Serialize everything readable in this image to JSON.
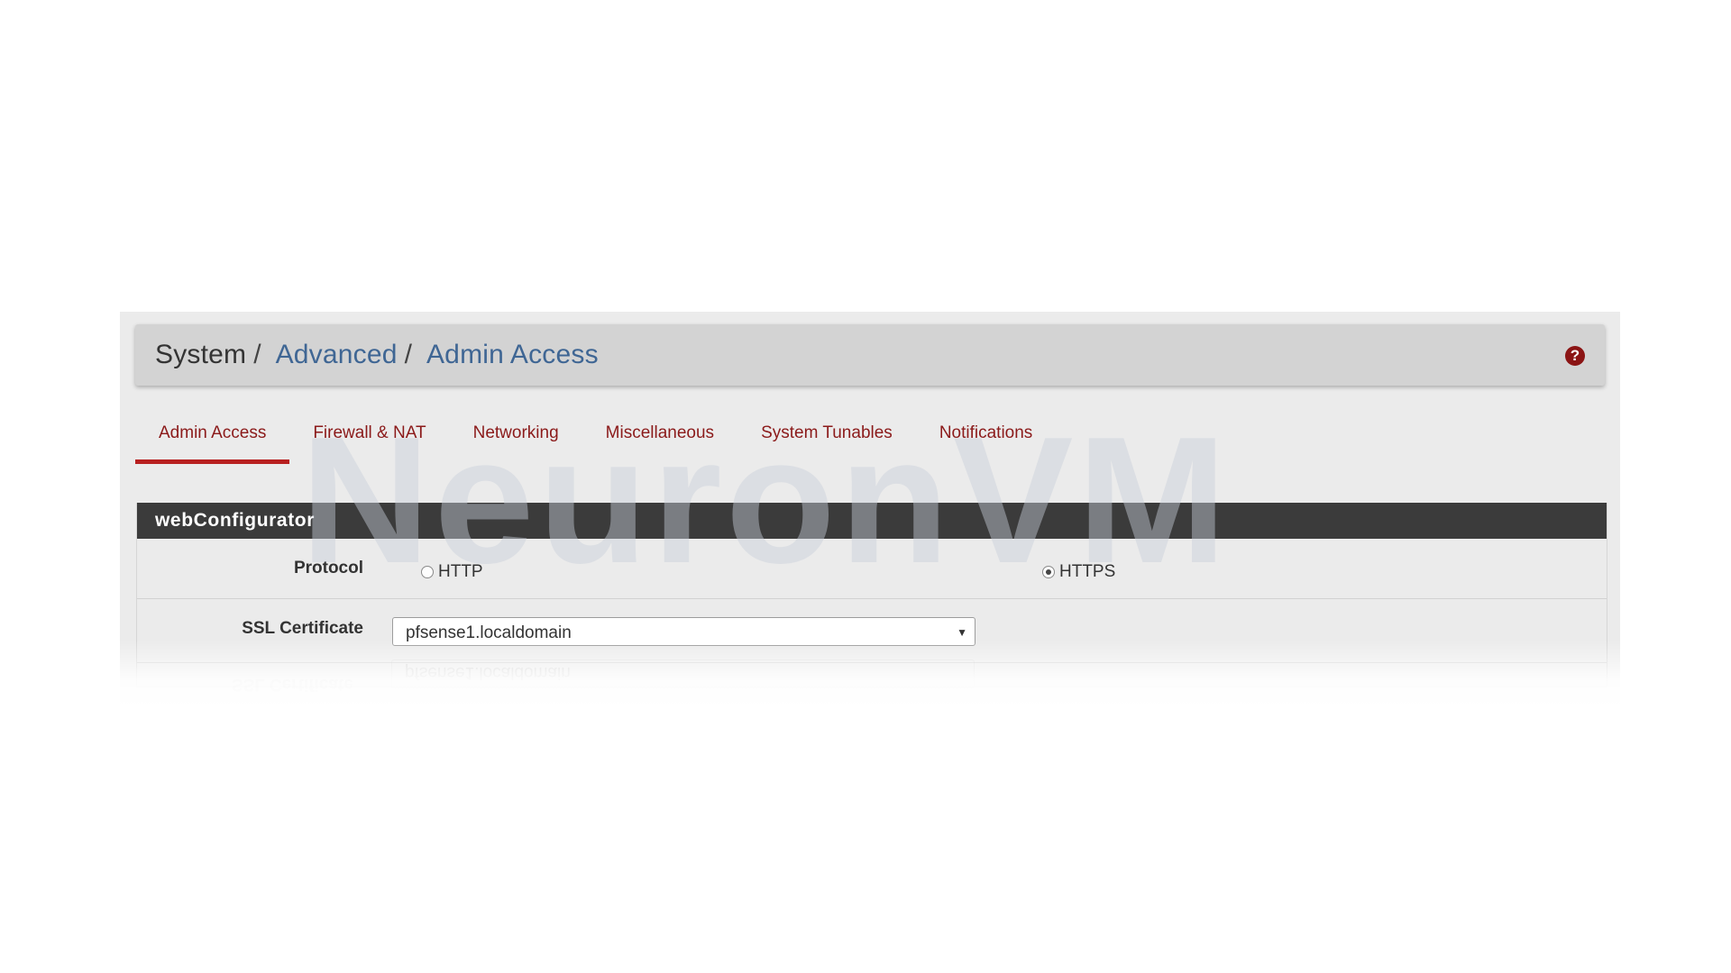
{
  "breadcrumb": {
    "root": "System",
    "separator": "/",
    "advanced": "Advanced",
    "current": "Admin Access"
  },
  "help_icon": {
    "glyph": "?",
    "name": "help-icon"
  },
  "watermark": "NeuronVM",
  "tabs": [
    {
      "label": "Admin Access",
      "active": true
    },
    {
      "label": "Firewall & NAT",
      "active": false
    },
    {
      "label": "Networking",
      "active": false
    },
    {
      "label": "Miscellaneous",
      "active": false
    },
    {
      "label": "System Tunables",
      "active": false
    },
    {
      "label": "Notifications",
      "active": false
    }
  ],
  "section": {
    "title": "webConfigurator",
    "protocol": {
      "label": "Protocol",
      "options": [
        {
          "label": "HTTP",
          "checked": false
        },
        {
          "label": "HTTPS",
          "checked": true
        }
      ]
    },
    "ssl_certificate": {
      "label": "SSL Certificate",
      "selected": "pfsense1.localdomain",
      "caret": "▼"
    }
  },
  "colors": {
    "accent_red": "#b81f1f",
    "tab_text": "#8b1a1a",
    "link_blue": "#3f6694",
    "header_dark": "#3b3b3b",
    "annotation_arrow": "#cc1f1f"
  }
}
